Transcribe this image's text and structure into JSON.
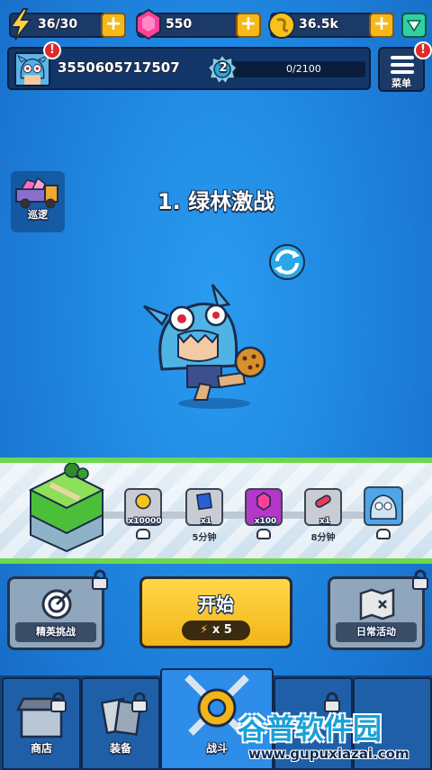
{
  "resources": {
    "energy": "36/30",
    "gems": "550",
    "coins": "36.5k"
  },
  "profile": {
    "player_id": "3550605717507",
    "level": "2",
    "xp": "0/2100",
    "alert": "!"
  },
  "menu": {
    "label": "菜单",
    "alert": "!"
  },
  "patrol": {
    "label": "巡逻"
  },
  "stage": {
    "title": "1. 绿林激战"
  },
  "rewards": [
    {
      "icon": "coin-icon",
      "count": "x10000",
      "caption": ""
    },
    {
      "icon": "card-icon",
      "count": "x1",
      "caption": "5分钟"
    },
    {
      "icon": "gem-icon",
      "count": "x100",
      "caption": ""
    },
    {
      "icon": "capsule-icon",
      "count": "x1",
      "caption": "8分钟"
    },
    {
      "icon": "hero-portrait-icon",
      "count": "",
      "caption": ""
    }
  ],
  "actions": {
    "elite": "精英挑战",
    "start": "开始",
    "start_cost": "x 5",
    "daily": "日常活动"
  },
  "tabs": {
    "shop": "商店",
    "equip": "装备",
    "battle": "战斗"
  },
  "watermark": {
    "text": "谷普软件园",
    "url": "www.gupuxiazai.com"
  }
}
